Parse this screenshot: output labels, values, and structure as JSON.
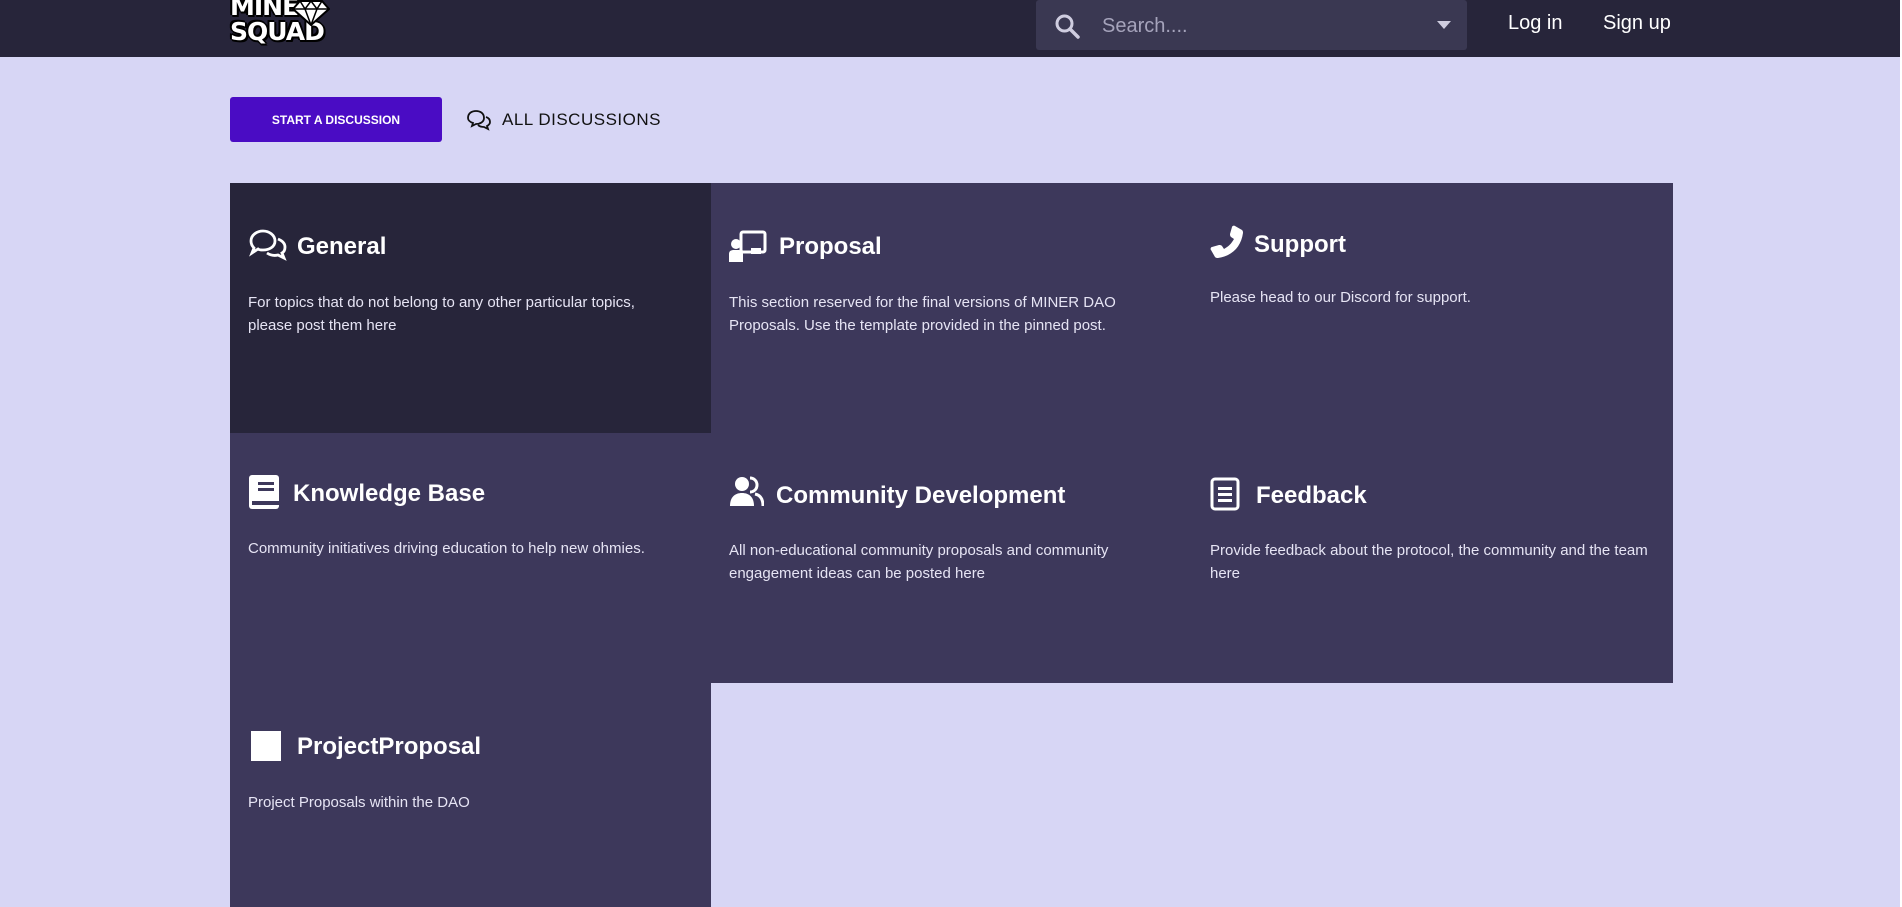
{
  "brand": {
    "logo_text": "MINER SQUAD"
  },
  "search": {
    "placeholder": "Search...."
  },
  "header": {
    "login_label": "Log in",
    "signup_label": "Sign up"
  },
  "toolbar": {
    "start_label": "START A DISCUSSION",
    "all_label": "ALL DISCUSSIONS"
  },
  "tags": [
    {
      "title": "General",
      "description": "For topics that do not belong to any other particular topics, please post them here",
      "icon": "comments-icon"
    },
    {
      "title": "Proposal",
      "description": "This section reserved for the final versions of MINER DAO Proposals. Use the template provided in the pinned post.",
      "icon": "presenter-icon"
    },
    {
      "title": "Support",
      "description": "Please head to our Discord for support.",
      "icon": "phone-icon"
    },
    {
      "title": "Knowledge Base",
      "description": "Community initiatives driving education to help new ohmies.",
      "icon": "book-icon"
    },
    {
      "title": "Community Development",
      "description": "All non-educational community proposals and community engagement ideas can be posted here",
      "icon": "users-icon"
    },
    {
      "title": "Feedback",
      "description": "Provide feedback about the protocol, the community and the team here",
      "icon": "document-icon"
    },
    {
      "title": "ProjectProposal",
      "description": "Project Proposals within the DAO",
      "icon": "square-icon"
    }
  ],
  "colors": {
    "header_bg": "#27253a",
    "page_bg": "#d7d6f5",
    "tile_bg": "#3d385b",
    "tile_dark_bg": "#27253a",
    "accent": "#4a0cc4"
  }
}
